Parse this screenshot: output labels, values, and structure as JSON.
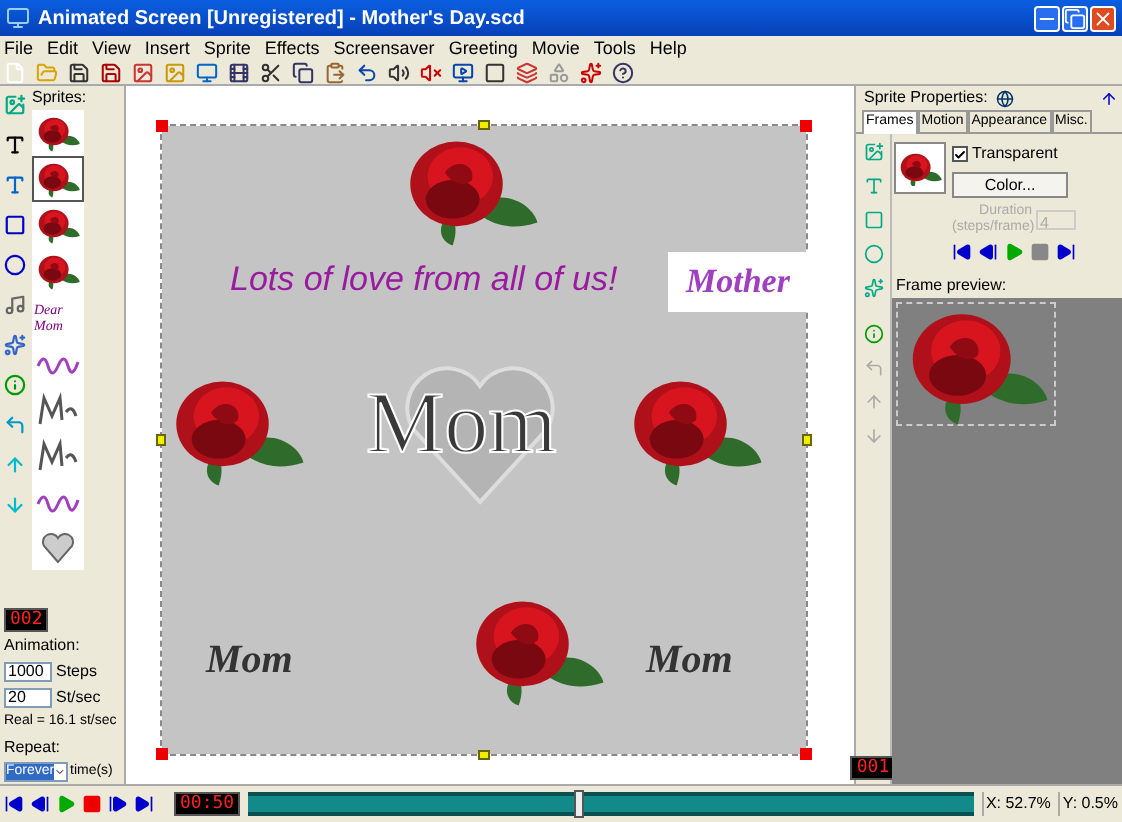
{
  "window": {
    "title": "Animated Screen [Unregistered] - Mother's Day.scd"
  },
  "menu": [
    "File",
    "Edit",
    "View",
    "Insert",
    "Sprite",
    "Effects",
    "Screensaver",
    "Greeting",
    "Movie",
    "Tools",
    "Help"
  ],
  "sprites_panel": {
    "label": "Sprites:",
    "items": [
      {
        "kind": "rose",
        "selected": false
      },
      {
        "kind": "rose",
        "selected": true
      },
      {
        "kind": "rose",
        "selected": false
      },
      {
        "kind": "rose",
        "selected": false
      },
      {
        "kind": "text",
        "text": "Dear Mom",
        "selected": false
      },
      {
        "kind": "scribble",
        "selected": false
      },
      {
        "kind": "outline",
        "selected": false
      },
      {
        "kind": "outline",
        "selected": false
      },
      {
        "kind": "scribble",
        "selected": false
      },
      {
        "kind": "heart",
        "selected": false
      }
    ]
  },
  "sprite_counter": "002",
  "animation": {
    "label": "Animation:",
    "steps": {
      "value": "1000",
      "unit": "Steps"
    },
    "speed": {
      "value": "20",
      "unit": "St/sec"
    },
    "real": "Real = 16.1 st/sec",
    "repeat_label": "Repeat:",
    "repeat": {
      "value": "Forever",
      "unit": "time(s)"
    }
  },
  "canvas": {
    "items": [
      {
        "kind": "rose"
      },
      {
        "kind": "caption",
        "text": "Lots of love from all of us!"
      },
      {
        "kind": "label",
        "text": "Mother"
      },
      {
        "kind": "rose"
      },
      {
        "kind": "heart",
        "text": "Mom"
      },
      {
        "kind": "rose"
      },
      {
        "kind": "doodle",
        "text": "Mom"
      },
      {
        "kind": "rose"
      },
      {
        "kind": "doodle",
        "text": "Mom"
      }
    ]
  },
  "properties": {
    "title": "Sprite Properties:",
    "tabs": [
      {
        "label": "Frames",
        "selected": true
      },
      {
        "label": "Motion",
        "selected": false
      },
      {
        "label": "Appearance",
        "selected": false
      },
      {
        "label": "Misc.",
        "selected": false
      }
    ],
    "transparent": {
      "label": "Transparent",
      "checked": true
    },
    "color_button": "Color...",
    "duration": {
      "label": "Duration (steps/frame)",
      "value": "4",
      "disabled": true
    },
    "preview_label": "Frame preview:",
    "frame_counter": "001"
  },
  "playback": {
    "time": "00:50",
    "level": 0.45
  },
  "status": {
    "x": "X: 52.7%",
    "y": "Y: 0.5%"
  }
}
